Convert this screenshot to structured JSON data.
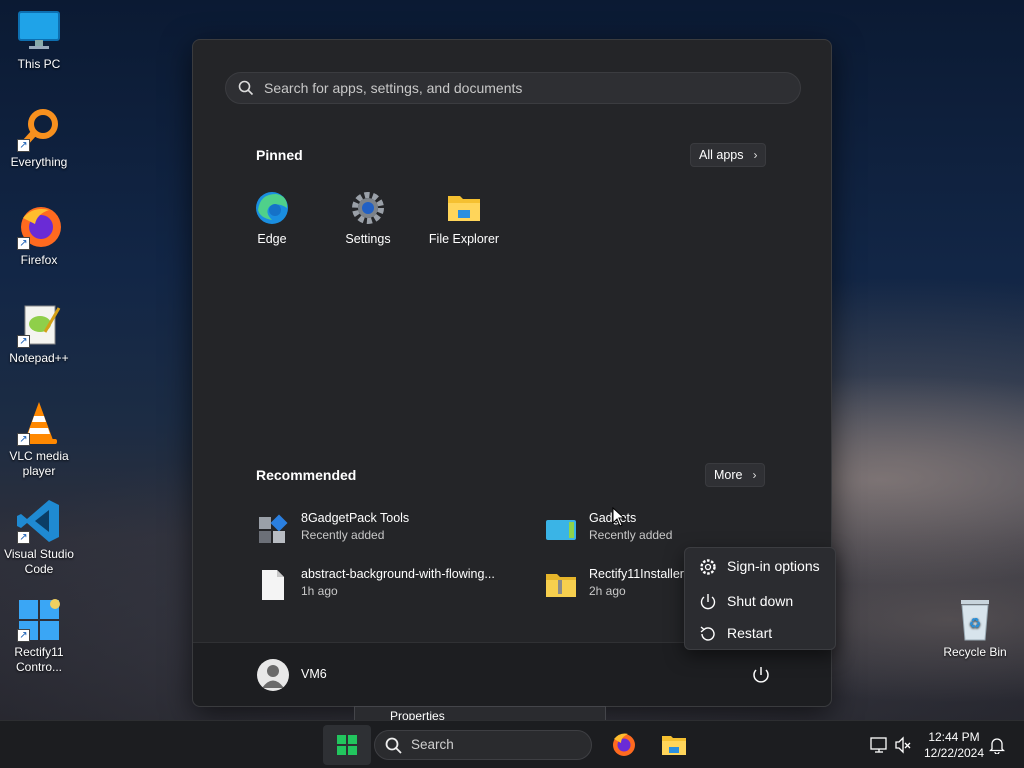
{
  "desktop": {
    "icons": [
      {
        "label": "This PC"
      },
      {
        "label": "Everything"
      },
      {
        "label": "Firefox"
      },
      {
        "label": "Notepad++"
      },
      {
        "label": "VLC media\nplayer"
      },
      {
        "label": "Visual Studio\nCode"
      },
      {
        "label": "Rectify11\nContro..."
      },
      {
        "label": "Recycle Bin"
      }
    ]
  },
  "start_menu": {
    "search_placeholder": "Search for apps, settings, and documents",
    "pinned_title": "Pinned",
    "all_apps_label": "All apps",
    "pinned": [
      {
        "label": "Edge",
        "icon": "edge-icon"
      },
      {
        "label": "Settings",
        "icon": "gear-icon"
      },
      {
        "label": "File Explorer",
        "icon": "folder-icon"
      }
    ],
    "recommended_title": "Recommended",
    "more_label": "More",
    "recommended": [
      {
        "name": "8GadgetPack Tools",
        "sub": "Recently added",
        "icon": "gadgetpack-icon"
      },
      {
        "name": "Gadgets",
        "sub": "Recently added",
        "icon": "gadgets-icon"
      },
      {
        "name": "abstract-background-with-flowing...",
        "sub": "1h ago",
        "icon": "document-icon"
      },
      {
        "name": "Rectify11Installer (",
        "sub": "2h ago",
        "icon": "zip-folder-icon"
      }
    ],
    "user_name": "VM6"
  },
  "power_flyout": {
    "items": [
      {
        "label": "Sign-in options",
        "icon": "gear-icon"
      },
      {
        "label": "Shut down",
        "icon": "power-icon"
      },
      {
        "label": "Restart",
        "icon": "restart-icon"
      }
    ]
  },
  "tooltip": {
    "label": "Properties"
  },
  "taskbar": {
    "search_label": "Search",
    "time": "12:44 PM",
    "date": "12/22/2024"
  },
  "colors": {
    "accent_blue": "#2aa4f4",
    "start_green": "#22c55e",
    "menu_bg": "#242528"
  }
}
